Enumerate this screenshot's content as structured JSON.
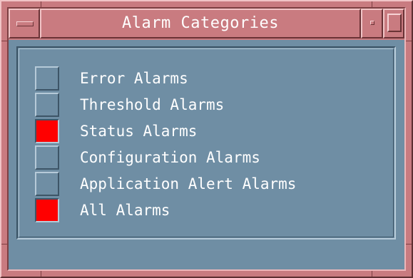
{
  "window": {
    "title": "Alarm Categories"
  },
  "titlebar_icons": {
    "menu": "window-menu-icon",
    "minimize": "minimize-icon",
    "maximize": "maximize-icon"
  },
  "colors": {
    "frame": "#c97b80",
    "client": "#6f8ea4",
    "checked": "#ff0000",
    "text": "#ffffff"
  },
  "categories": [
    {
      "label": "Error Alarms",
      "checked": false
    },
    {
      "label": "Threshold Alarms",
      "checked": false
    },
    {
      "label": "Status Alarms",
      "checked": true
    },
    {
      "label": "Configuration Alarms",
      "checked": false
    },
    {
      "label": "Application Alert Alarms",
      "checked": false
    },
    {
      "label": "All Alarms",
      "checked": true
    }
  ]
}
